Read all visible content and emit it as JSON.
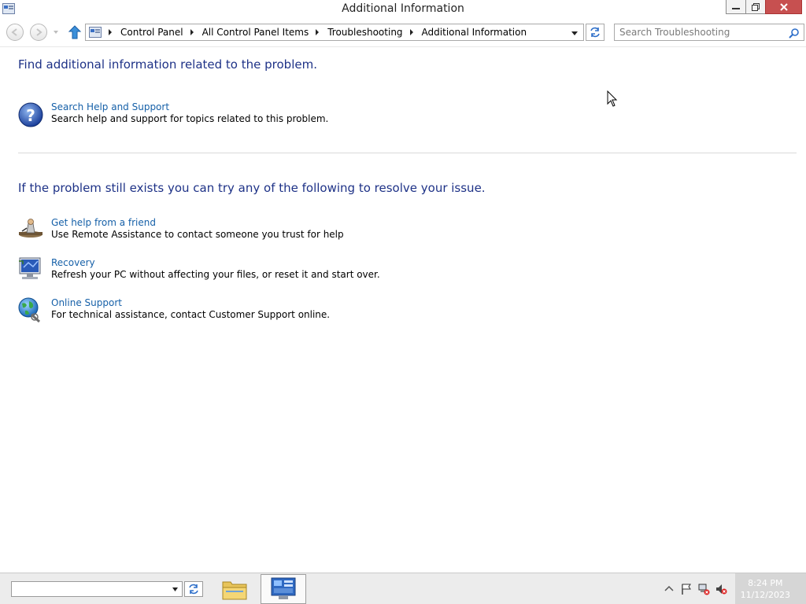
{
  "window": {
    "title": "Additional Information",
    "minimize_label": "",
    "maximize_label": "",
    "close_label": ""
  },
  "navigation": {
    "breadcrumbs": [
      "Control Panel",
      "All Control Panel Items",
      "Troubleshooting",
      "Additional Information"
    ],
    "search_placeholder": "Search Troubleshooting"
  },
  "main": {
    "heading_1": "Find additional information related to the problem.",
    "help_item": {
      "icon": "help-question-icon",
      "link": "Search Help and Support",
      "description": "Search help and support for topics related to this problem."
    },
    "heading_2": "If the problem still exists you can try any of the following to resolve your issue.",
    "options": [
      {
        "icon": "remote-assistance-icon",
        "link": "Get help from a friend",
        "description": "Use Remote Assistance to contact someone you trust for help"
      },
      {
        "icon": "recovery-icon",
        "link": "Recovery",
        "description": "Refresh your PC without affecting your files, or reset it and start over."
      },
      {
        "icon": "globe-support-icon",
        "link": "Online Support",
        "description": "For technical assistance, contact Customer Support online."
      }
    ]
  },
  "taskbar": {
    "apps": [
      "file-explorer-icon",
      "control-panel-icon"
    ],
    "tray_icons": [
      "show-hidden-icon",
      "action-center-flag-icon",
      "network-icon",
      "volume-muted-icon"
    ],
    "time": "8:24 PM",
    "date": "11/12/2023"
  },
  "colors": {
    "heading": "#1e3287",
    "link": "#1660a8",
    "close_button": "#c75050"
  }
}
